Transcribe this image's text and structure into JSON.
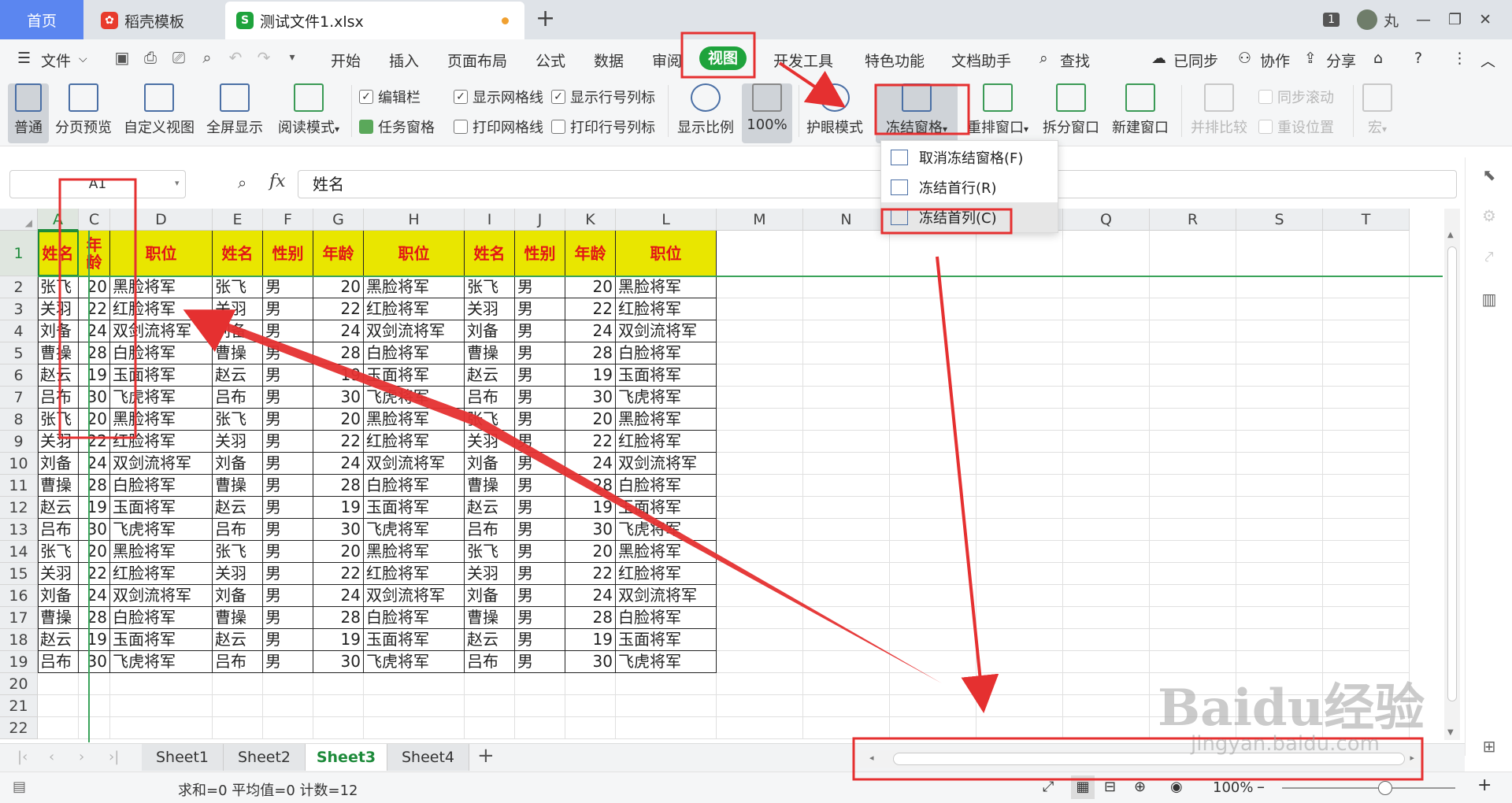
{
  "tabs": {
    "home": "首页",
    "template": "稻壳模板",
    "file": "测试文件1.xlsx",
    "add": "+"
  },
  "window": {
    "badge": "1",
    "user": "丸"
  },
  "menu": {
    "file": "文件",
    "items": [
      "开始",
      "插入",
      "页面布局",
      "公式",
      "数据",
      "审阅",
      "视图",
      "开发工具",
      "特色功能",
      "文档助手"
    ],
    "search": "查找",
    "synced": "已同步",
    "collab": "协作",
    "share": "分享"
  },
  "ribbon": {
    "normal": "普通",
    "pagebreak": "分页预览",
    "customview": "自定义视图",
    "fullscreen": "全屏显示",
    "readmode": "阅读模式",
    "editbar": "编辑栏",
    "taskpane": "任务窗格",
    "showgrid": "显示网格线",
    "printgrid": "打印网格线",
    "showheaders": "显示行号列标",
    "printheaders": "打印行号列标",
    "zoom": "显示比例",
    "zoom100": "100%",
    "eyecare": "护眼模式",
    "freeze": "冻结窗格",
    "arrange": "重排窗口",
    "split": "拆分窗口",
    "newwin": "新建窗口",
    "sidebyside": "并排比较",
    "syncscroll": "同步滚动",
    "resetpos": "重设位置",
    "macro": "宏"
  },
  "freeze_menu": {
    "unfreeze": "取消冻结窗格(F)",
    "freeze_row": "冻结首行(R)",
    "freeze_col": "冻结首列(C)"
  },
  "formula_bar": {
    "cell_ref": "A1",
    "fx": "fx",
    "value": "姓名"
  },
  "columns": [
    "A",
    "C",
    "D",
    "E",
    "F",
    "G",
    "H",
    "I",
    "J",
    "K",
    "L",
    "M",
    "N",
    "O",
    "P",
    "Q",
    "R",
    "S",
    "T"
  ],
  "header_row": [
    "姓名",
    "年龄",
    "职位",
    "姓名",
    "性别",
    "年龄",
    "职位",
    "姓名",
    "性别",
    "年龄",
    "职位"
  ],
  "rows": [
    [
      "张飞",
      "20",
      "黑脸将军",
      "张飞",
      "男",
      "20",
      "黑脸将军",
      "张飞",
      "男",
      "20",
      "黑脸将军"
    ],
    [
      "关羽",
      "22",
      "红脸将军",
      "关羽",
      "男",
      "22",
      "红脸将军",
      "关羽",
      "男",
      "22",
      "红脸将军"
    ],
    [
      "刘备",
      "24",
      "双剑流将军",
      "刘备",
      "男",
      "24",
      "双剑流将军",
      "刘备",
      "男",
      "24",
      "双剑流将军"
    ],
    [
      "曹操",
      "28",
      "白脸将军",
      "曹操",
      "男",
      "28",
      "白脸将军",
      "曹操",
      "男",
      "28",
      "白脸将军"
    ],
    [
      "赵云",
      "19",
      "玉面将军",
      "赵云",
      "男",
      "19",
      "玉面将军",
      "赵云",
      "男",
      "19",
      "玉面将军"
    ],
    [
      "吕布",
      "30",
      "飞虎将军",
      "吕布",
      "男",
      "30",
      "飞虎将军",
      "吕布",
      "男",
      "30",
      "飞虎将军"
    ],
    [
      "张飞",
      "20",
      "黑脸将军",
      "张飞",
      "男",
      "20",
      "黑脸将军",
      "张飞",
      "男",
      "20",
      "黑脸将军"
    ],
    [
      "关羽",
      "22",
      "红脸将军",
      "关羽",
      "男",
      "22",
      "红脸将军",
      "关羽",
      "男",
      "22",
      "红脸将军"
    ],
    [
      "刘备",
      "24",
      "双剑流将军",
      "刘备",
      "男",
      "24",
      "双剑流将军",
      "刘备",
      "男",
      "24",
      "双剑流将军"
    ],
    [
      "曹操",
      "28",
      "白脸将军",
      "曹操",
      "男",
      "28",
      "白脸将军",
      "曹操",
      "男",
      "28",
      "白脸将军"
    ],
    [
      "赵云",
      "19",
      "玉面将军",
      "赵云",
      "男",
      "19",
      "玉面将军",
      "赵云",
      "男",
      "19",
      "玉面将军"
    ],
    [
      "吕布",
      "30",
      "飞虎将军",
      "吕布",
      "男",
      "30",
      "飞虎将军",
      "吕布",
      "男",
      "30",
      "飞虎将军"
    ],
    [
      "张飞",
      "20",
      "黑脸将军",
      "张飞",
      "男",
      "20",
      "黑脸将军",
      "张飞",
      "男",
      "20",
      "黑脸将军"
    ],
    [
      "关羽",
      "22",
      "红脸将军",
      "关羽",
      "男",
      "22",
      "红脸将军",
      "关羽",
      "男",
      "22",
      "红脸将军"
    ],
    [
      "刘备",
      "24",
      "双剑流将军",
      "刘备",
      "男",
      "24",
      "双剑流将军",
      "刘备",
      "男",
      "24",
      "双剑流将军"
    ],
    [
      "曹操",
      "28",
      "白脸将军",
      "曹操",
      "男",
      "28",
      "白脸将军",
      "曹操",
      "男",
      "28",
      "白脸将军"
    ],
    [
      "赵云",
      "19",
      "玉面将军",
      "赵云",
      "男",
      "19",
      "玉面将军",
      "赵云",
      "男",
      "19",
      "玉面将军"
    ],
    [
      "吕布",
      "30",
      "飞虎将军",
      "吕布",
      "男",
      "30",
      "飞虎将军",
      "吕布",
      "男",
      "30",
      "飞虎将军"
    ]
  ],
  "row_numbers": [
    "1",
    "2",
    "3",
    "4",
    "5",
    "6",
    "7",
    "8",
    "9",
    "10",
    "11",
    "12",
    "13",
    "14",
    "15",
    "16",
    "17",
    "18",
    "19",
    "20",
    "21",
    "22"
  ],
  "sheets": [
    "Sheet1",
    "Sheet2",
    "Sheet3",
    "Sheet4"
  ],
  "active_sheet": "Sheet3",
  "status": {
    "summary": "求和=0  平均值=0  计数=12",
    "zoom": "100%"
  },
  "watermark": {
    "logo": "Baidu经验",
    "url": "jingyan.baidu.com"
  },
  "colors": {
    "accent": "#1ea33c",
    "header_fill": "#e9e600",
    "header_text": "#e21616",
    "annotation": "#e53030"
  }
}
